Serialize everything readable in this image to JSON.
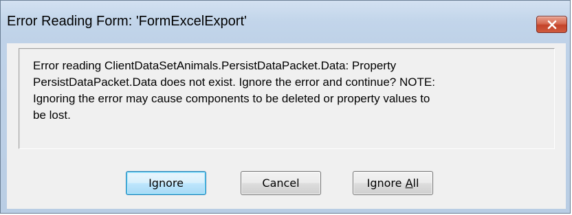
{
  "dialog": {
    "title": "Error Reading Form: 'FormExcelExport'",
    "close_icon": "close-x-icon",
    "close_color": "#c4442a",
    "message_lines": [
      "Error reading ClientDataSetAnimals.PersistDataPacket.Data: Property",
      "PersistDataPacket.Data does not exist.  Ignore the error and continue?  NOTE:",
      "Ignoring the error may cause components to be deleted or property values to",
      "be lost."
    ],
    "buttons": {
      "ignore": "Ignore",
      "cancel": "Cancel",
      "ignore_all_prefix": "Ignore ",
      "ignore_all_underlined": "A",
      "ignore_all_suffix": "ll"
    }
  }
}
